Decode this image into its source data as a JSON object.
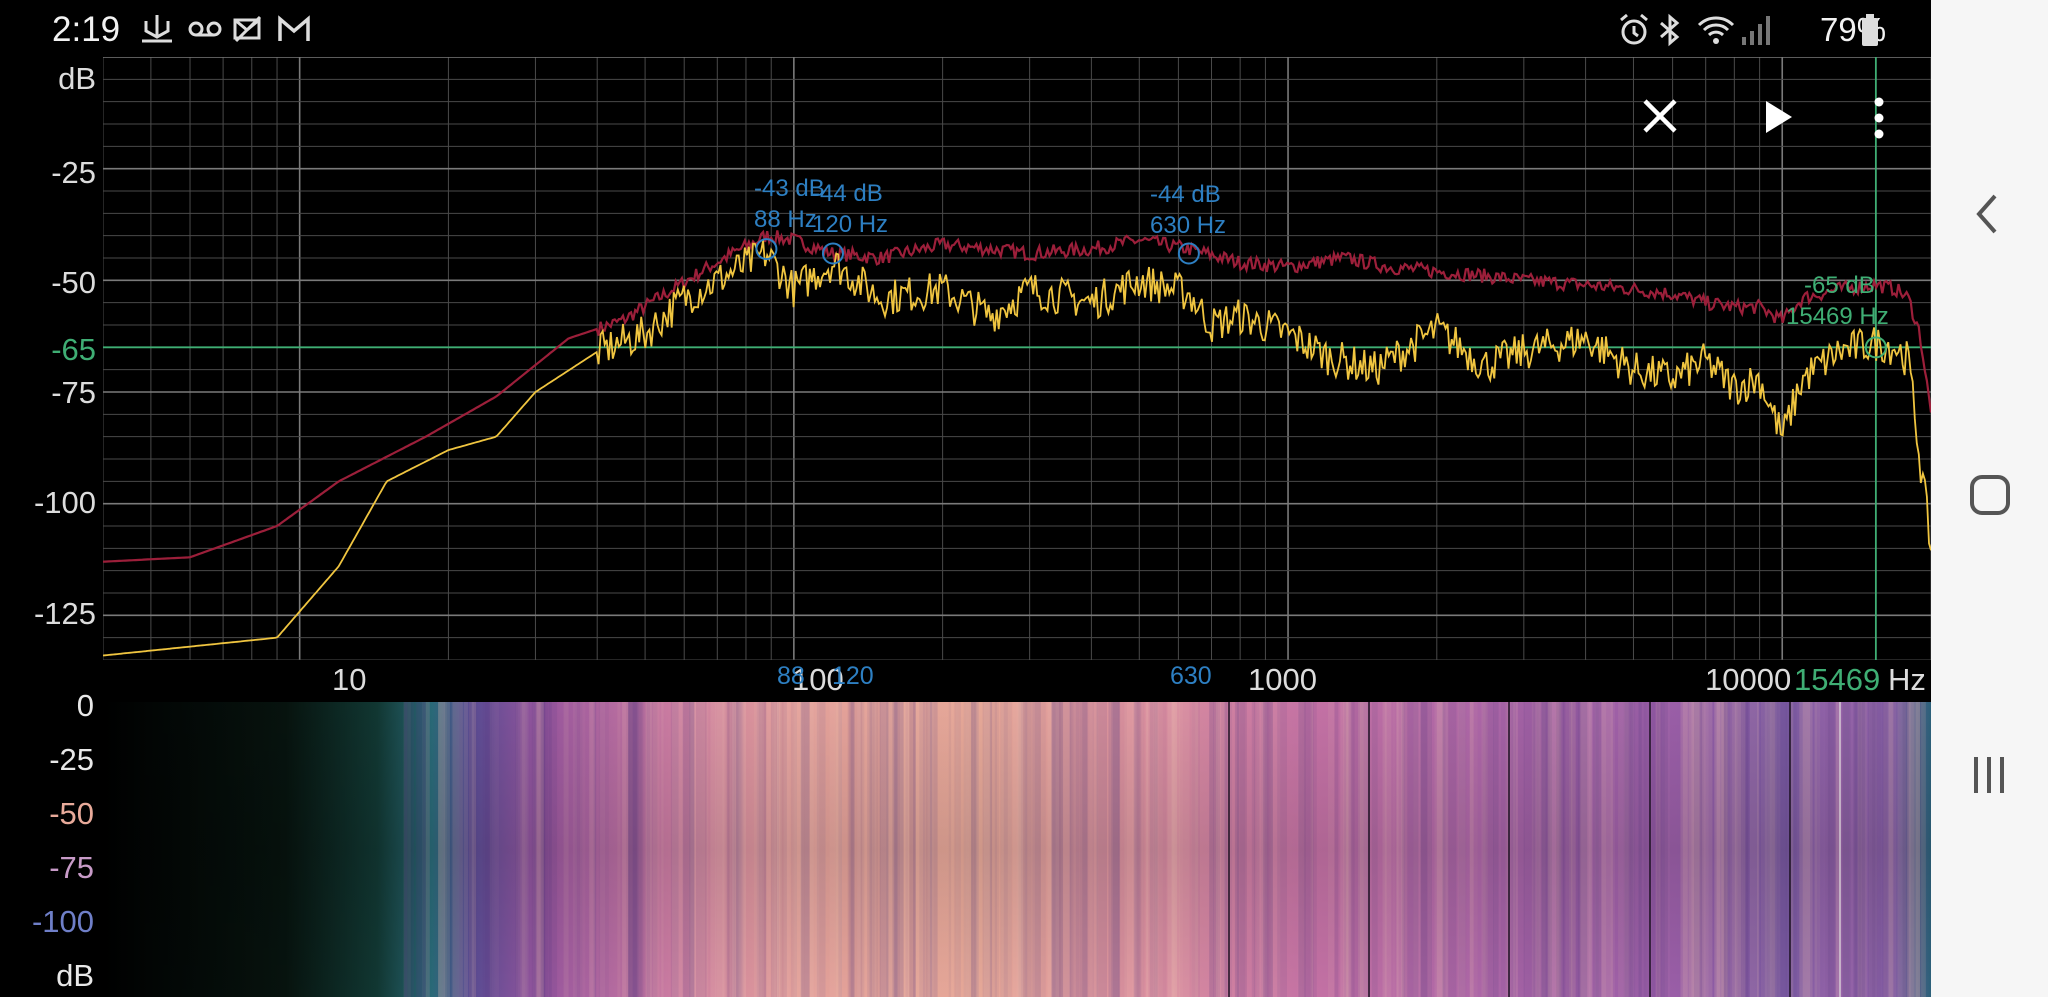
{
  "status_bar": {
    "time": "2:19",
    "battery_percent": "79%",
    "left_icons": [
      "usb-debug-icon",
      "voicemail-icon",
      "no-data-icon",
      "gmail-icon"
    ],
    "right_icons": [
      "alarm-icon",
      "bluetooth-icon",
      "wifi-icon",
      "signal-icon",
      "battery-icon"
    ]
  },
  "toolbar": {
    "buttons": [
      "close-icon",
      "play-icon",
      "more-vert-icon"
    ]
  },
  "spectrum": {
    "y_unit": "dB",
    "y_ticks": [
      "-25",
      "-50",
      "-75",
      "-100",
      "-125"
    ],
    "cursor_y_label": "-65",
    "x_ticks": [
      "10",
      "100",
      "1000",
      "10000"
    ],
    "x_unit": "Hz",
    "cursor_x_label": "15469",
    "peak_ticks": [
      "88",
      "120",
      "630"
    ],
    "peaks": [
      {
        "db": "-43 dB",
        "hz": "88 Hz"
      },
      {
        "db": "-44 dB",
        "hz": "120 Hz"
      },
      {
        "db": "-44 dB",
        "hz": "630 Hz"
      }
    ],
    "cursor": {
      "db": "-65 dB",
      "hz": "15469 Hz"
    },
    "colors": {
      "peak_hold": "#9c1f3a",
      "live": "#f0c540",
      "grid": "#4a4a4a",
      "cursor": "#3fae74",
      "marker": "#2d7fc2"
    }
  },
  "chart_data": {
    "type": "line",
    "title": "",
    "xlabel": "Hz",
    "ylabel": "dB",
    "x_scale": "log",
    "xlim": [
      4,
      20000
    ],
    "ylim": [
      -135,
      0
    ],
    "series": [
      {
        "x": [
          4,
          6,
          9,
          12,
          18,
          25,
          35,
          45,
          55,
          65,
          75,
          88,
          100,
          120,
          150,
          200,
          250,
          300,
          400,
          500,
          630,
          800,
          1000,
          1300,
          1600,
          2000,
          2500,
          3000,
          4000,
          5000,
          6000,
          7000,
          8000,
          9000,
          10000,
          11000,
          13000,
          15469,
          17000,
          18000,
          19000,
          20000
        ],
        "y": [
          -113,
          -112,
          -105,
          -95,
          -85,
          -76,
          -63,
          -59,
          -53,
          -48,
          -44,
          -40,
          -41,
          -44,
          -45,
          -42,
          -43,
          -44,
          -43,
          -41,
          -43,
          -46,
          -47,
          -45,
          -47,
          -48,
          -49,
          -50,
          -51,
          -52,
          -53,
          -55,
          -56,
          -56,
          -59,
          -54,
          -52,
          -51,
          -52,
          -54,
          -62,
          -80
        ]
      },
      {
        "x": [
          4,
          6,
          9,
          12,
          15,
          20,
          25,
          30,
          40,
          50,
          60,
          70,
          88,
          100,
          120,
          150,
          200,
          250,
          300,
          400,
          500,
          630,
          700,
          800,
          1000,
          1200,
          1500,
          2000,
          2500,
          3000,
          4000,
          5000,
          6000,
          7000,
          8000,
          9000,
          10000,
          11000,
          13000,
          15469,
          17000,
          18000,
          19000,
          20000
        ],
        "y": [
          -134,
          -132,
          -130,
          -114,
          -95,
          -88,
          -85,
          -75,
          -66,
          -62,
          -54,
          -50,
          -44,
          -52,
          -46,
          -54,
          -52,
          -58,
          -52,
          -55,
          -50,
          -53,
          -60,
          -58,
          -62,
          -67,
          -70,
          -61,
          -69,
          -66,
          -63,
          -70,
          -72,
          -68,
          -74,
          -72,
          -85,
          -72,
          -66,
          -64,
          -65,
          -68,
          -90,
          -110
        ]
      }
    ]
  },
  "spectrogram": {
    "y_ticks": [
      "0",
      "-25",
      "-50",
      "-75",
      "-100"
    ],
    "y_unit": "dB"
  },
  "nav_bar": {
    "buttons": [
      "back-icon",
      "home-icon",
      "recents-icon"
    ]
  }
}
